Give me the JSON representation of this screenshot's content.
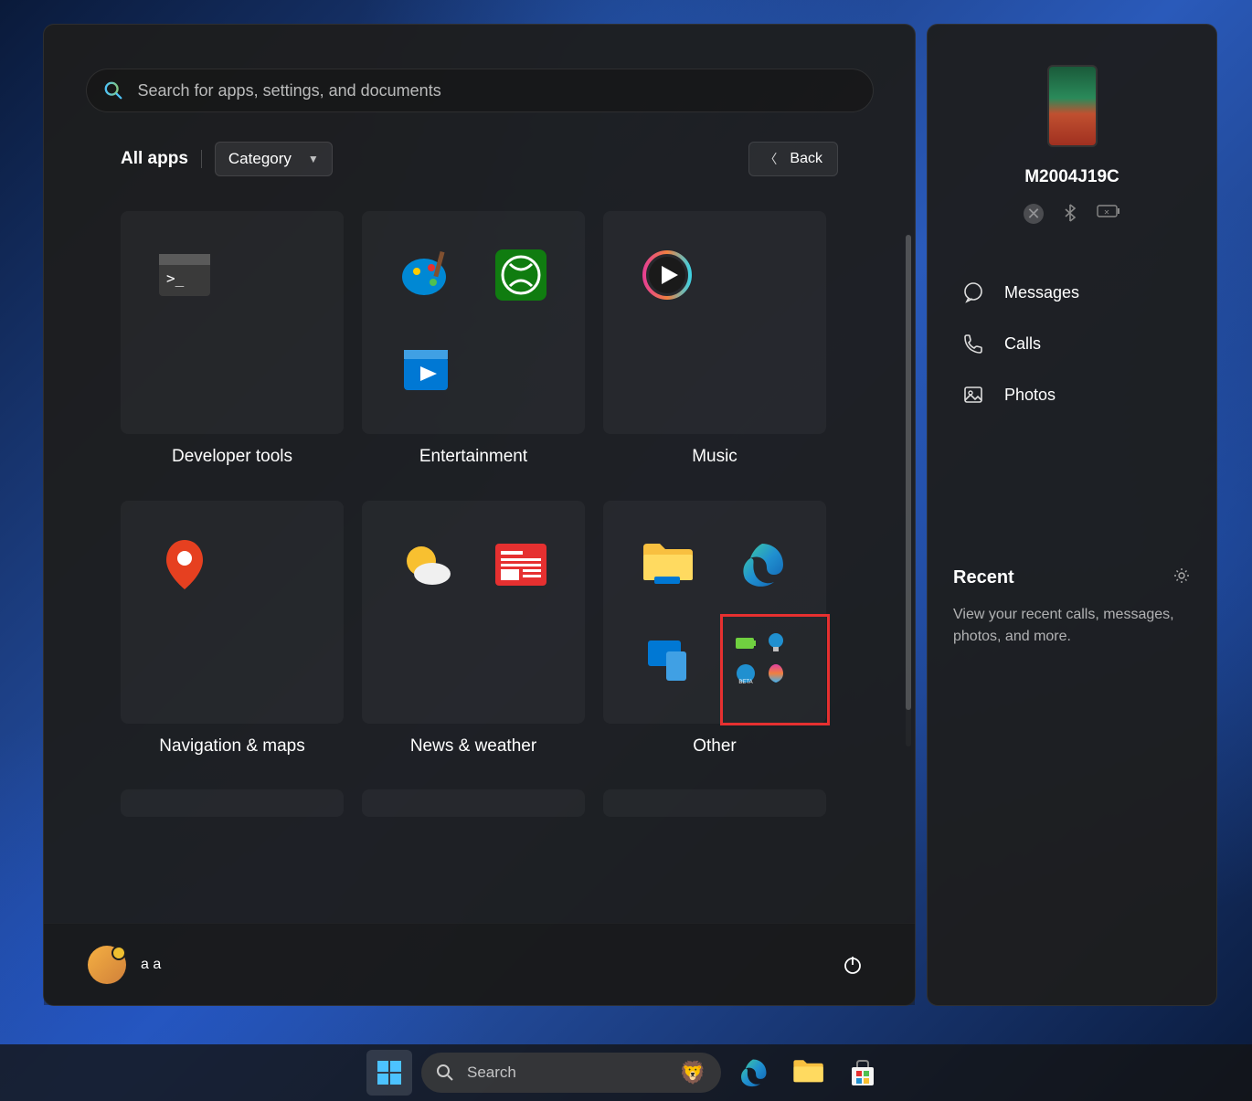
{
  "search": {
    "placeholder": "Search for apps, settings, and documents"
  },
  "header": {
    "all_apps": "All apps",
    "category": "Category",
    "back": "Back"
  },
  "categories": [
    {
      "name": "Developer tools",
      "apps": [
        "terminal"
      ]
    },
    {
      "name": "Entertainment",
      "apps": [
        "paint",
        "xbox",
        "clipchamp"
      ]
    },
    {
      "name": "Music",
      "apps": [
        "media-player"
      ]
    },
    {
      "name": "Navigation & maps",
      "apps": [
        "maps"
      ]
    },
    {
      "name": "News & weather",
      "apps": [
        "weather",
        "news"
      ]
    },
    {
      "name": "Other",
      "apps": [
        "file-explorer",
        "edge",
        "phone-link",
        "mini-cluster"
      ]
    }
  ],
  "user": {
    "name": "a a"
  },
  "phone": {
    "device_name": "M2004J19C",
    "actions": {
      "messages": "Messages",
      "calls": "Calls",
      "photos": "Photos"
    },
    "recent": {
      "title": "Recent",
      "text": "View your recent calls, messages, photos, and more."
    }
  },
  "taskbar": {
    "search": "Search"
  },
  "highlight": {
    "target": "other-mini-cluster"
  }
}
